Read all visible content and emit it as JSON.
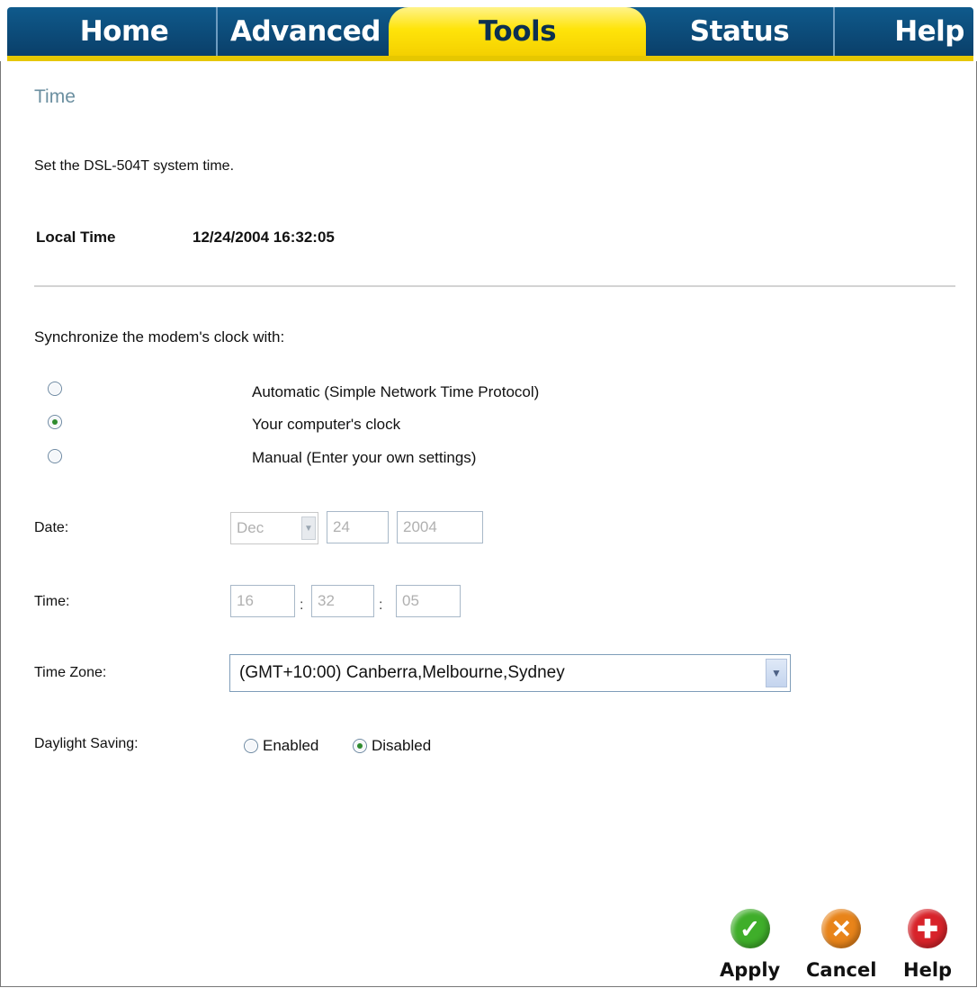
{
  "tabs": [
    {
      "label": "Home",
      "active": false
    },
    {
      "label": "Advanced",
      "active": false
    },
    {
      "label": "Tools",
      "active": true
    },
    {
      "label": "Status",
      "active": false
    },
    {
      "label": "Help",
      "active": false
    }
  ],
  "page": {
    "title": "Time",
    "description": "Set the DSL-504T system time.",
    "local_time_label": "Local Time",
    "local_time_value": "12/24/2004 16:32:05"
  },
  "sync": {
    "heading": "Synchronize the modem's clock with:",
    "options": [
      {
        "label": "Automatic (Simple Network Time Protocol)",
        "checked": false
      },
      {
        "label": "Your computer's clock",
        "checked": true
      },
      {
        "label": "Manual (Enter your own settings)",
        "checked": false
      }
    ]
  },
  "date": {
    "label": "Date:",
    "month": "Dec",
    "day": "24",
    "year": "2004"
  },
  "time": {
    "label": "Time:",
    "hour": "16",
    "minute": "32",
    "second": "05",
    "separator": ":"
  },
  "timezone": {
    "label": "Time Zone:",
    "value": "(GMT+10:00) Canberra,Melbourne,Sydney"
  },
  "daylight": {
    "label": "Daylight Saving:",
    "enabled_label": "Enabled",
    "disabled_label": "Disabled",
    "enabled": false
  },
  "actions": {
    "apply": "Apply",
    "cancel": "Cancel",
    "help": "Help"
  },
  "colors": {
    "tab_blue": "#0f5a8c",
    "tab_active": "#ffe40a",
    "title": "#6b8fa0",
    "apply": "#3fae2a",
    "cancel": "#e8841a",
    "help": "#d8232a"
  },
  "icons": {
    "apply": "check-icon",
    "cancel": "x-icon",
    "help": "plus-icon"
  }
}
